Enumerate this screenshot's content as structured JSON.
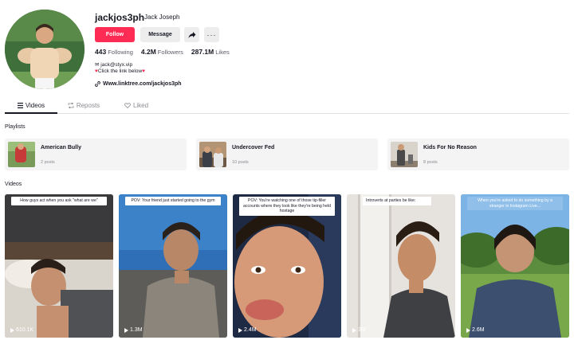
{
  "profile": {
    "username": "jackjos3ph",
    "nickname": "Jack Joseph",
    "follow_label": "Follow",
    "message_label": "Message",
    "more_label": "···",
    "following_count": "443",
    "following_label": "Following",
    "followers_count": "4.2M",
    "followers_label": "Followers",
    "likes_count": "287.1M",
    "likes_label": "Likes",
    "bio_email": "jack@styx.vip",
    "bio_cta": "Click the link below",
    "link": "Www.linktree.com/jackjos3ph"
  },
  "tabs": [
    {
      "label": "Videos",
      "icon": "grid-icon",
      "active": true
    },
    {
      "label": "Reposts",
      "icon": "repost-icon",
      "active": false
    },
    {
      "label": "Liked",
      "icon": "liked-icon",
      "active": false
    }
  ],
  "playlists_label": "Playlists",
  "playlists": [
    {
      "title": "American Bully",
      "count": "2 posts"
    },
    {
      "title": "Undercover Fed",
      "count": "10 posts"
    },
    {
      "title": "Kids For No Reason",
      "count": "8 posts"
    }
  ],
  "videos_label": "Videos",
  "videos": [
    {
      "caption": "How guys act when you ask \"what are we\"",
      "views": "610.1K"
    },
    {
      "caption": "POV: Your friend just started going to the gym",
      "views": "1.3M"
    },
    {
      "caption": "POV: You're watching one of those tip-filler accounts where they look like they're being held hostage",
      "views": "2.4M"
    },
    {
      "caption": "Introverts at parties be like:",
      "views": "3M"
    },
    {
      "caption": "When you're asked to do something by a stranger in Instagram Live...",
      "views": "2.6M"
    }
  ],
  "colors": {
    "accent": "#fe2c55",
    "text": "#161823",
    "muted": "#8a8b91",
    "button_bg": "#ededee"
  }
}
